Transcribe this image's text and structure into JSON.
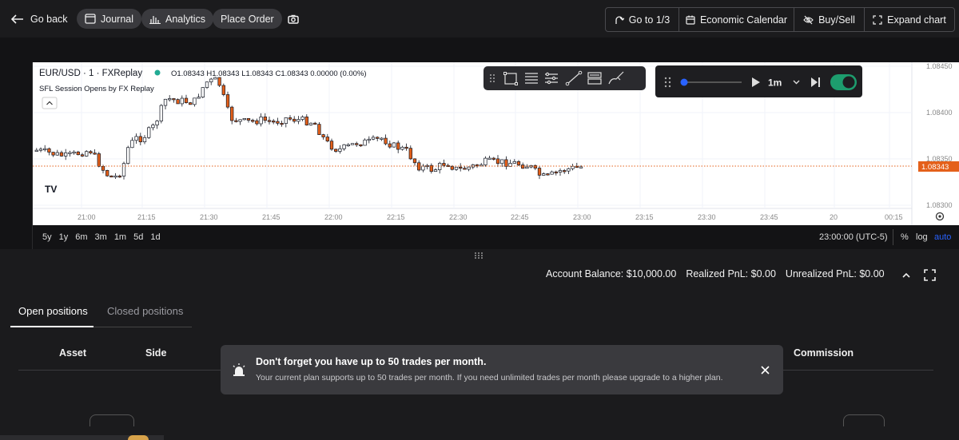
{
  "topbar": {
    "go_back": "Go back",
    "journal": "Journal",
    "analytics": "Analytics",
    "place_order": "Place Order",
    "go_to": "Go to 1/3",
    "economic_calendar": "Economic Calendar",
    "buy_sell": "Buy/Sell",
    "expand_chart": "Expand chart"
  },
  "chart": {
    "symbol": "EUR/USD · 1 · FXReplay",
    "ohlc": "O1.08343 H1.08343 L1.08343 C1.08343 0.00000 (0.00%)",
    "indicator": "SFL Session Opens by FX Replay",
    "price_labels": [
      "1.08450",
      "1.08400",
      "1.08350",
      "1.08300"
    ],
    "current_price": "1.08343",
    "time_labels": [
      "21:00",
      "21:15",
      "21:30",
      "21:45",
      "22:00",
      "22:15",
      "22:30",
      "22:45",
      "23:00",
      "23:15",
      "23:30",
      "23:45",
      "20",
      "00:15"
    ],
    "ranges": [
      "5y",
      "1y",
      "6m",
      "3m",
      "1m",
      "5d",
      "1d"
    ],
    "clock": "23:00:00 (UTC-5)",
    "pct": "%",
    "log": "log",
    "auto": "auto",
    "logo": "TV",
    "accent": "#e4601a",
    "up_color": "#ffffff",
    "down_color": "#e4601a"
  },
  "replay": {
    "speed": "1m"
  },
  "account": {
    "balance": "Account Balance: $10,000.00",
    "realized": "Realized PnL: $0.00",
    "unrealized": "Unrealized PnL: $0.00"
  },
  "tabs": {
    "open": "Open positions",
    "closed": "Closed positions"
  },
  "columns": {
    "asset": "Asset",
    "side": "Side",
    "commission": "Commission"
  },
  "popup": {
    "title": "Don't forget you have up to 50 trades per month.",
    "body": "Your current plan supports up to 50 trades per month. If you need unlimited trades per month please upgrade to a higher plan."
  }
}
